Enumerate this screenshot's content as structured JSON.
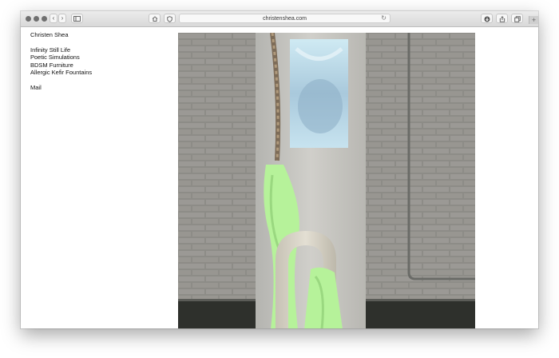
{
  "browser": {
    "url": "christenshea.com"
  },
  "site": {
    "title": "Christen Shea",
    "nav": [
      "Infinity Still Life",
      "Poetic Simulations",
      "BDSM Furniture",
      "Allergic Kefir Fountains"
    ],
    "mail": "Mail"
  },
  "colors": {
    "accent_green": "#b6f29a",
    "wall": "#9a9893"
  }
}
